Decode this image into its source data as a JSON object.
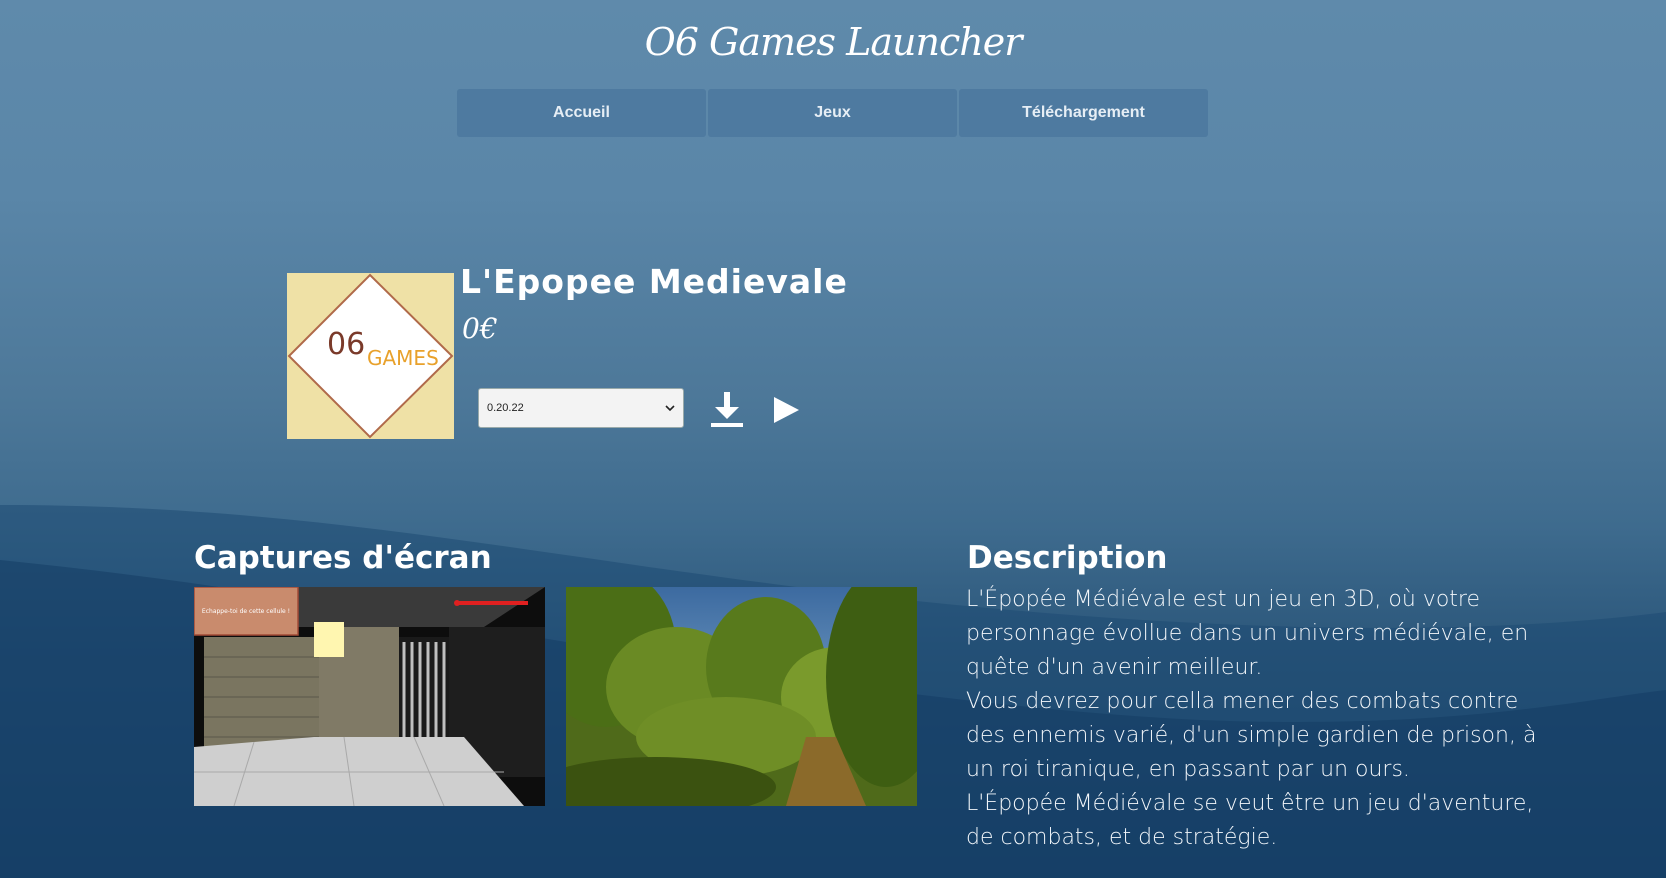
{
  "app": {
    "title": "O6 Games Launcher"
  },
  "nav": {
    "items": [
      {
        "label": "Accueil"
      },
      {
        "label": "Jeux"
      },
      {
        "label": "Téléchargement"
      }
    ]
  },
  "game": {
    "title": "L'Epopee Medievale",
    "price": "0€",
    "logo_text_a": "06",
    "logo_text_b": "GAMES",
    "version": {
      "selected": "0.20.22"
    },
    "download_icon": "download-icon",
    "play_icon": "play-icon"
  },
  "screenshots": {
    "title": "Captures d'écran",
    "shot1_caption": "Echappe-toi de cette cellule !"
  },
  "description": {
    "title": "Description",
    "paragraphs": [
      "L'Épopée Médiévale est un jeu en 3D, où votre personnage évollue dans un univers médiévale, en quête d'un avenir meilleur.",
      "Vous devrez pour cella mener des combats contre des ennemis varié, d'un simple gardien de prison, à un roi tiranique, en passant par un ours.",
      "L'Épopée Médiévale se veut être un jeu d'aventure, de combats, et de stratégie."
    ]
  },
  "colors": {
    "nav_bg": "#4e7aa0",
    "logo_bg": "#efe1a6",
    "logo_accent": "#e8a12b"
  }
}
